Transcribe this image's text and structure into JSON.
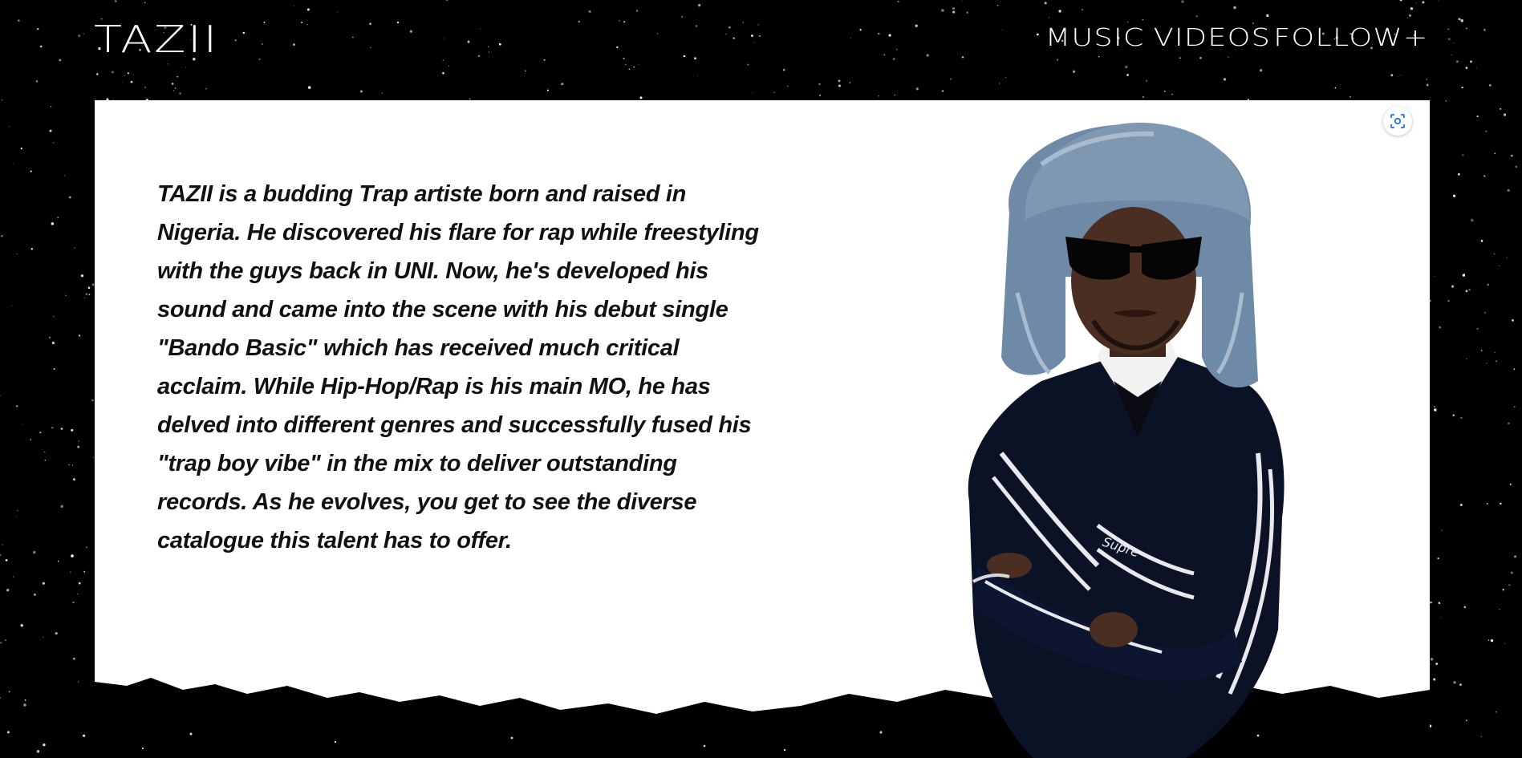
{
  "header": {
    "logo": "TAZII",
    "nav": [
      {
        "label": "MUSIC"
      },
      {
        "label": "VIDEOS"
      },
      {
        "label": "FOLLOW+"
      }
    ]
  },
  "bio": {
    "name": "TAZII",
    "text": " is a budding Trap artiste born and raised in Nigeria. He discovered his flare for rap while freestyling with the guys back in UNI. Now, he's developed his sound and came into the scene with his debut single \"Bando Basic\" which has received much critical acclaim. While Hip-Hop/Rap is his main MO, he has delved into different genres and successfully fused his \"trap boy vibe\" in the mix to deliver outstanding records. As he evolves, you get to see the diverse catalogue this talent has to offer."
  },
  "image": {
    "brand_text": "Supre"
  },
  "icons": {
    "lens_icon": "visual-search-icon"
  },
  "colors": {
    "background": "#000000",
    "panel": "#ffffff",
    "text": "#111111",
    "lens_accent": "#1a73e8"
  }
}
